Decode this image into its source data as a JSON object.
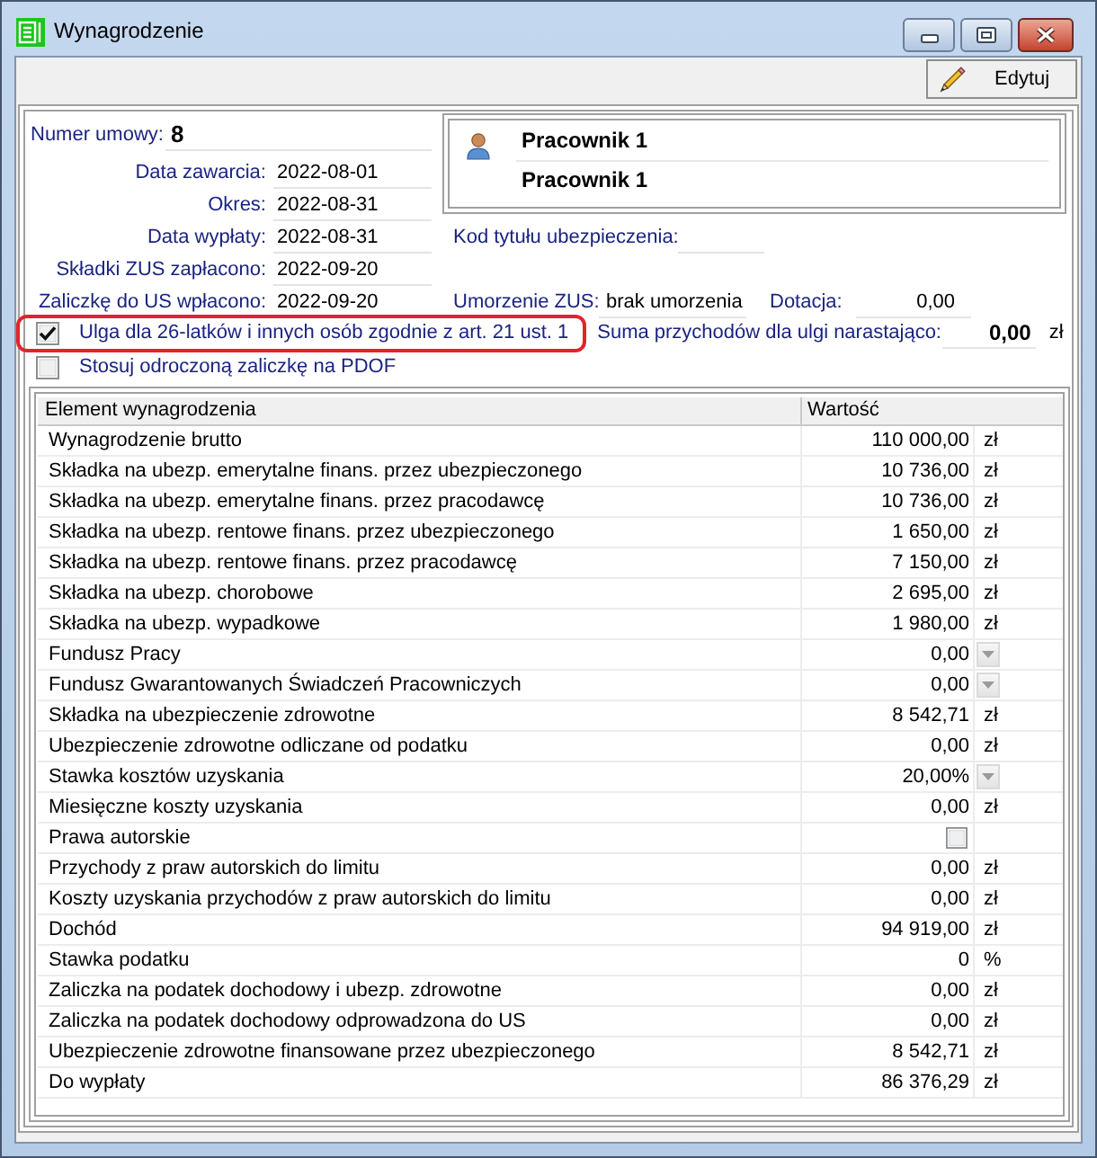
{
  "window": {
    "title": "Wynagrodzenie"
  },
  "toolbar": {
    "edit_button": "Edytuj"
  },
  "contract": {
    "label": "Numer umowy:",
    "value": "8"
  },
  "dates": [
    {
      "label": "Data zawarcia:",
      "value": "2022-08-01"
    },
    {
      "label": "Okres:",
      "value": "2022-08-31"
    },
    {
      "label": "Data wypłaty:",
      "value": "2022-08-31"
    },
    {
      "label": "Składki ZUS zapłacono:",
      "value": "2022-09-20"
    },
    {
      "label": "Zaliczkę do US wpłacono:",
      "value": "2022-09-20"
    }
  ],
  "employee": {
    "lines": [
      "Pracownik 1",
      "Pracownik 1"
    ]
  },
  "insurance_code": {
    "label": "Kod tytułu ubezpieczenia:"
  },
  "zus_remission": {
    "label": "Umorzenie ZUS:",
    "value": "brak umorzenia"
  },
  "subsidy": {
    "label": "Dotacja:",
    "value": "0,00"
  },
  "options": [
    {
      "label": "Ulga dla 26-latków i innych osób zgodnie z art. 21 ust. 1",
      "checked": true,
      "highlighted": true
    },
    {
      "label": "Stosuj odroczoną zaliczkę na PDOF",
      "checked": false,
      "highlighted": false
    }
  ],
  "relief_total": {
    "label": "Suma przychodów dla ulgi narastająco:",
    "value": "0,00",
    "unit": "zł"
  },
  "table": {
    "columns": [
      "Element wynagrodzenia",
      "Wartość"
    ],
    "rows": [
      {
        "kind": "amount",
        "name": "Wynagrodzenie brutto",
        "value": "110 000,00",
        "unit": "zł"
      },
      {
        "kind": "amount",
        "name": "Składka na ubezp. emerytalne finans. przez ubezpieczonego",
        "value": "10 736,00",
        "unit": "zł"
      },
      {
        "kind": "amount",
        "name": "Składka na ubezp. emerytalne finans. przez pracodawcę",
        "value": "10 736,00",
        "unit": "zł"
      },
      {
        "kind": "amount",
        "name": "Składka na ubezp. rentowe finans. przez ubezpieczonego",
        "value": "1 650,00",
        "unit": "zł"
      },
      {
        "kind": "amount",
        "name": "Składka na ubezp. rentowe finans. przez pracodawcę",
        "value": "7 150,00",
        "unit": "zł"
      },
      {
        "kind": "amount",
        "name": "Składka na ubezp. chorobowe",
        "value": "2 695,00",
        "unit": "zł"
      },
      {
        "kind": "amount",
        "name": "Składka na ubezp. wypadkowe",
        "value": "1 980,00",
        "unit": "zł"
      },
      {
        "kind": "dropdown",
        "name": "Fundusz Pracy",
        "value": "0,00"
      },
      {
        "kind": "dropdown",
        "name": "Fundusz Gwarantowanych Świadczeń Pracowniczych",
        "value": "0,00"
      },
      {
        "kind": "amount",
        "name": "Składka na ubezpieczenie zdrowotne",
        "value": "8 542,71",
        "unit": "zł"
      },
      {
        "kind": "amount",
        "name": "Ubezpieczenie zdrowotne odliczane od podatku",
        "value": "0,00",
        "unit": "zł"
      },
      {
        "kind": "dropdown",
        "name": "Stawka kosztów uzyskania",
        "value": "20,00%"
      },
      {
        "kind": "amount",
        "name": "Miesięczne koszty uzyskania",
        "value": "0,00",
        "unit": "zł"
      },
      {
        "kind": "checkbox",
        "name": "Prawa autorskie",
        "checked": false
      },
      {
        "kind": "amount",
        "name": "Przychody z praw autorskich do limitu",
        "value": "0,00",
        "unit": "zł"
      },
      {
        "kind": "amount",
        "name": "Koszty uzyskania przychodów z praw autorskich do limitu",
        "value": "0,00",
        "unit": "zł"
      },
      {
        "kind": "amount",
        "name": "Dochód",
        "value": "94 919,00",
        "unit": "zł"
      },
      {
        "kind": "amount",
        "name": "Stawka podatku",
        "value": "0",
        "unit": "%"
      },
      {
        "kind": "amount",
        "name": "Zaliczka na podatek dochodowy i ubezp. zdrowotne",
        "value": "0,00",
        "unit": "zł"
      },
      {
        "kind": "amount",
        "name": "Zaliczka na podatek dochodowy odprowadzona do US",
        "value": "0,00",
        "unit": "zł"
      },
      {
        "kind": "amount",
        "name": "Ubezpieczenie zdrowotne finansowane przez ubezpieczonego",
        "value": "8 542,71",
        "unit": "zł"
      },
      {
        "kind": "amount",
        "name": "Do wypłaty",
        "value": "86 376,29",
        "unit": "zł"
      }
    ]
  }
}
